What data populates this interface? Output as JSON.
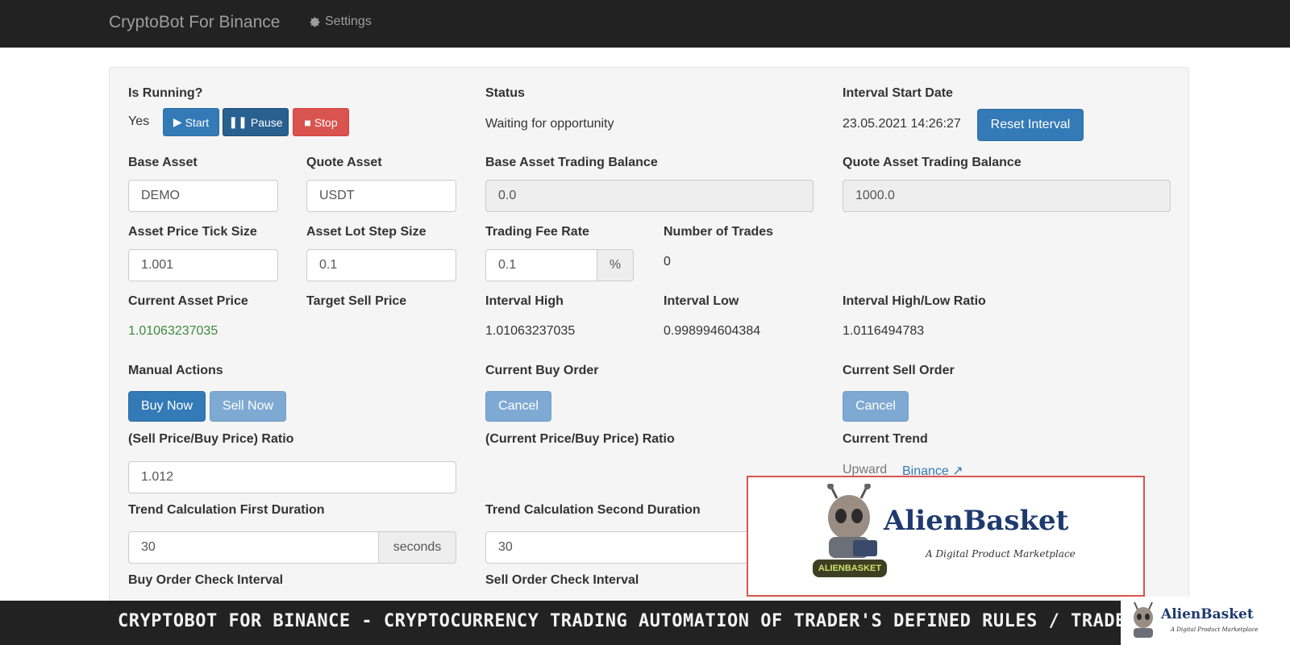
{
  "navbar": {
    "brand": "CryptoBot For Binance",
    "settings_label": "Settings"
  },
  "running": {
    "label": "Is Running?",
    "value": "Yes",
    "start_label": "Start",
    "pause_label": "Pause",
    "stop_label": "Stop"
  },
  "status": {
    "label": "Status",
    "value": "Waiting for opportunity"
  },
  "interval_start": {
    "label": "Interval Start Date",
    "value": "23.05.2021 14:26:27",
    "reset_label": "Reset Interval"
  },
  "base_asset": {
    "label": "Base Asset",
    "value": "DEMO"
  },
  "quote_asset": {
    "label": "Quote Asset",
    "value": "USDT"
  },
  "base_balance": {
    "label": "Base Asset Trading Balance",
    "value": "0.0"
  },
  "quote_balance": {
    "label": "Quote Asset Trading Balance",
    "value": "1000.0"
  },
  "tick_size": {
    "label": "Asset Price Tick Size",
    "value": "1.001"
  },
  "lot_step": {
    "label": "Asset Lot Step Size",
    "value": "0.1"
  },
  "fee_rate": {
    "label": "Trading Fee Rate",
    "value": "0.1",
    "unit": "%"
  },
  "num_trades": {
    "label": "Number of Trades",
    "value": "0"
  },
  "current_price": {
    "label": "Current Asset Price",
    "value": "1.01063237035"
  },
  "target_sell": {
    "label": "Target Sell Price"
  },
  "interval_high": {
    "label": "Interval High",
    "value": "1.01063237035"
  },
  "interval_low": {
    "label": "Interval Low",
    "value": "0.998994604384"
  },
  "hl_ratio": {
    "label": "Interval High/Low Ratio",
    "value": "1.0116494783"
  },
  "manual": {
    "label": "Manual Actions",
    "buy_label": "Buy Now",
    "sell_label": "Sell Now"
  },
  "buy_order": {
    "label": "Current Buy Order",
    "cancel_label": "Cancel"
  },
  "sell_order": {
    "label": "Current Sell Order",
    "cancel_label": "Cancel"
  },
  "sell_buy_ratio": {
    "label": "(Sell Price/Buy Price) Ratio",
    "value": "1.012"
  },
  "cur_buy_ratio": {
    "label": "(Current Price/Buy Price) Ratio"
  },
  "trend": {
    "label": "Current Trend",
    "value": "Upward",
    "link": "Binance"
  },
  "trend_first": {
    "label": "Trend Calculation First Duration",
    "value": "30",
    "unit": "seconds"
  },
  "trend_second": {
    "label": "Trend Calculation Second Duration",
    "value": "30"
  },
  "buy_check": {
    "label": "Buy Order Check Interval"
  },
  "sell_check": {
    "label": "Sell Order Check Interval"
  },
  "ad": {
    "title": "AlienBasket",
    "tagline": "A Digital Product Marketplace",
    "badge": "ALIENBASKET"
  },
  "banner": {
    "text": "CRYPTOBOT FOR BINANCE - CRYPTOCURRENCY TRADING AUTOMATION OF TRADER'S DEFINED RULES / TRADE ST"
  },
  "corner_logo": {
    "title": "AlienBasket",
    "tagline": "A Digital Product Marketplace"
  },
  "colors": {
    "navbar": "#222222",
    "primary": "#337ab7",
    "danger": "#d9534f",
    "price_green": "#3c8b3c"
  }
}
